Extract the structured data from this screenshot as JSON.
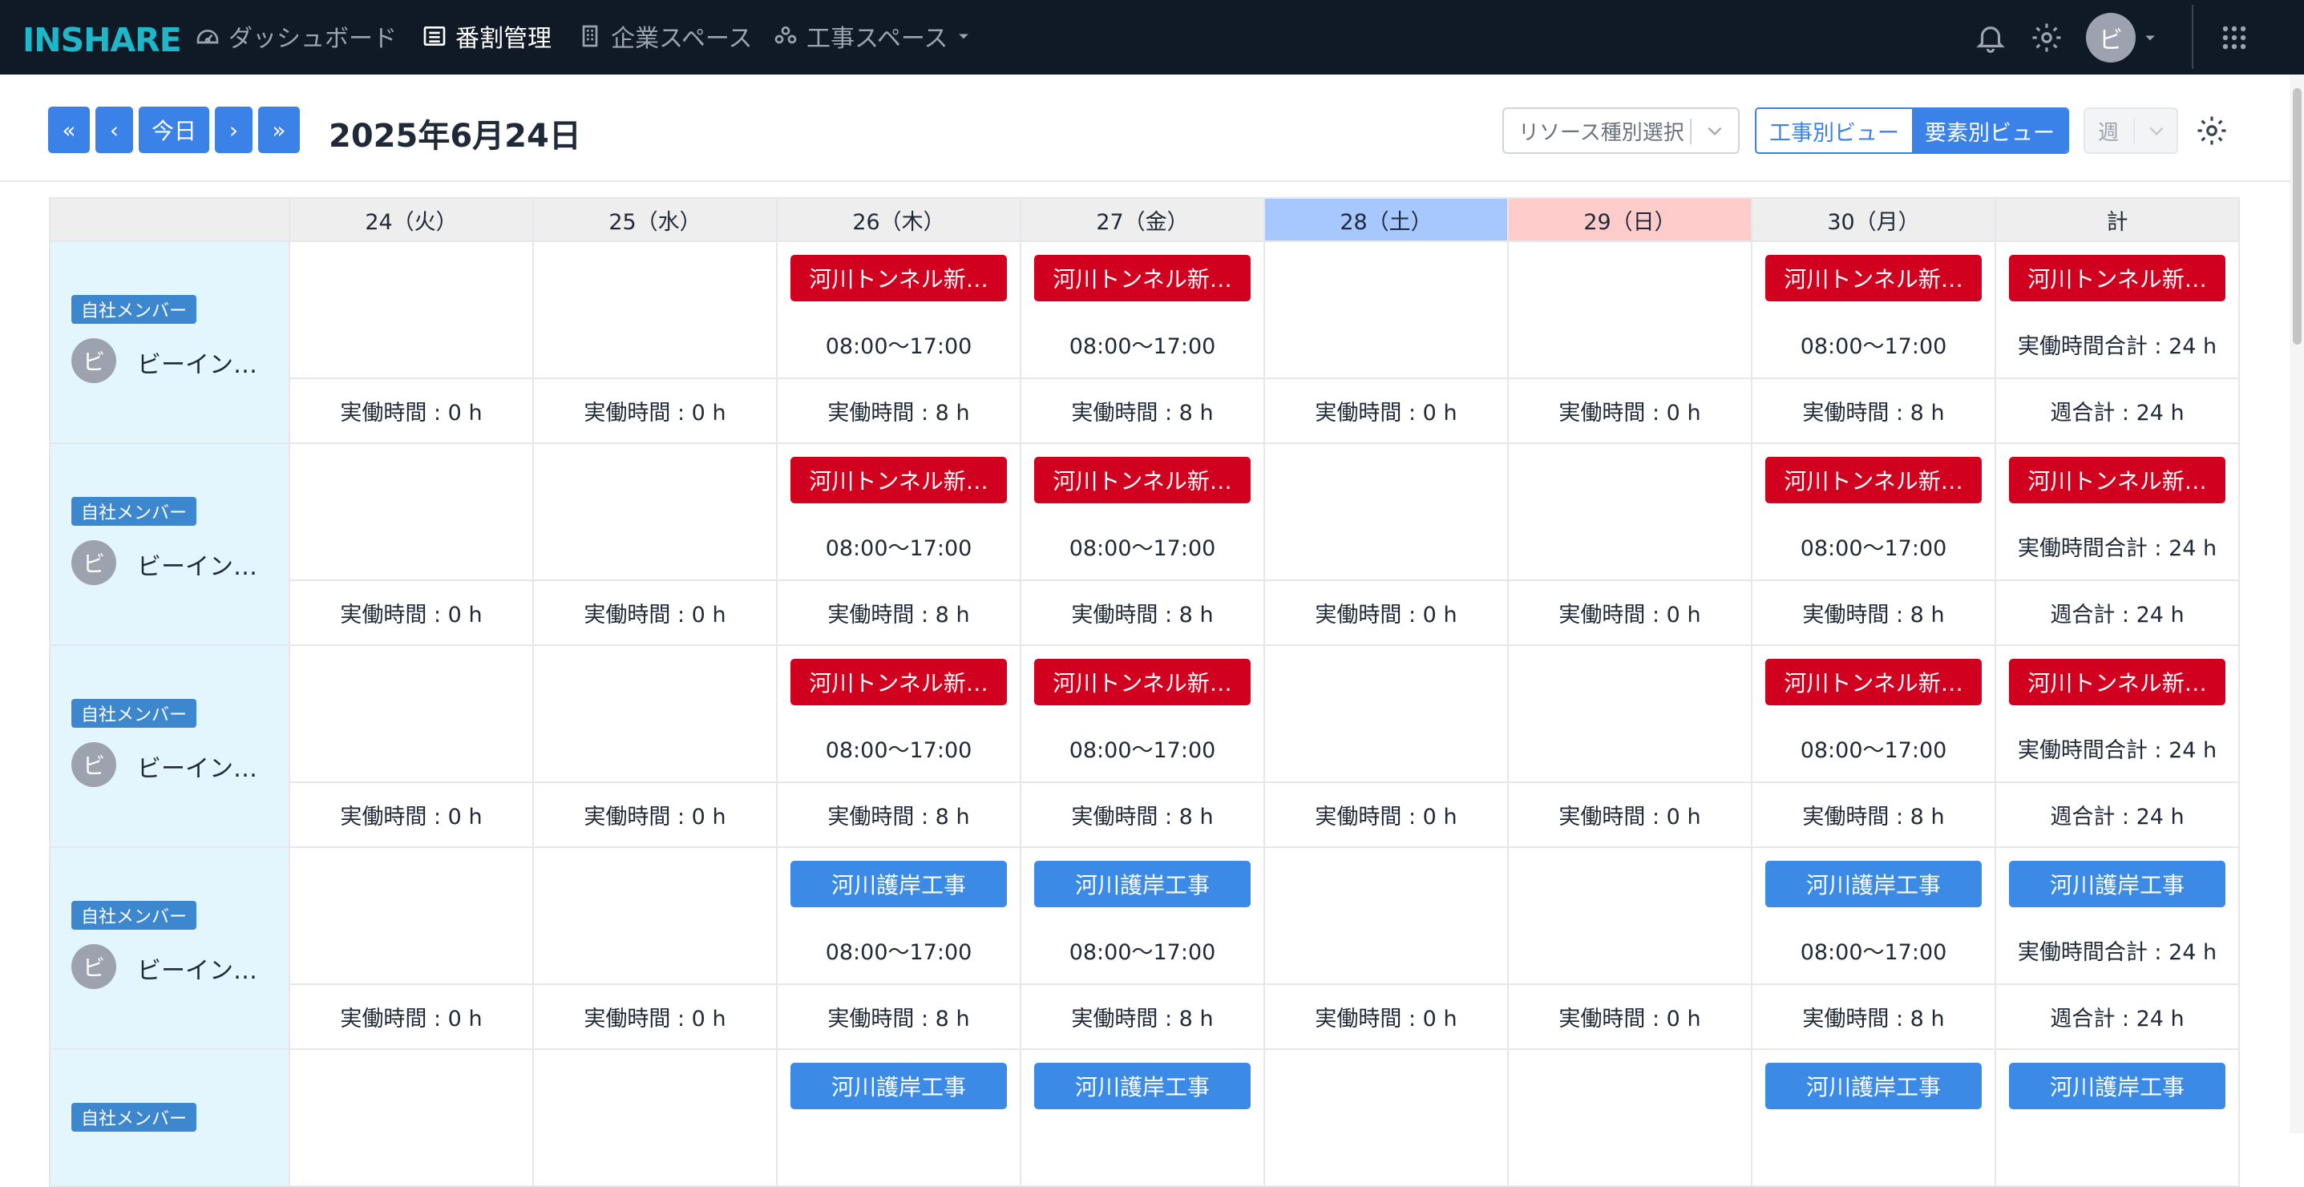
{
  "nav": {
    "logo": "INSHARE",
    "items": [
      {
        "label": "ダッシュボード",
        "icon": "dashboard-icon"
      },
      {
        "label": "番割管理",
        "icon": "list-icon"
      },
      {
        "label": "企業スペース",
        "icon": "building-icon"
      },
      {
        "label": "工事スペース",
        "icon": "users-icon"
      }
    ],
    "avatar": "ビ"
  },
  "toolbar": {
    "first": "«",
    "prev": "‹",
    "today": "今日",
    "next": "›",
    "last": "»",
    "date": "2025年6月24日",
    "resource_placeholder": "リソース種別選択",
    "view_by_project": "工事別ビュー",
    "view_by_element": "要素別ビュー",
    "period": "週"
  },
  "columns": [
    "24（火）",
    "25（水）",
    "26（木）",
    "27（金）",
    "28（土）",
    "29（日）",
    "30（月）",
    "計"
  ],
  "badge": "自社メンバー",
  "rows": [
    {
      "avatar": "ビ",
      "name": "ビーイン…",
      "tag": "河川トンネル新…",
      "time": "08:00〜17:00",
      "hours": [
        "実働時間 : 0 h",
        "実働時間 : 0 h",
        "実働時間 : 8 h",
        "実働時間 : 8 h",
        "実働時間 : 0 h",
        "実働時間 : 0 h",
        "実働時間 : 8 h",
        "週合計 : 24 h"
      ],
      "total": "実働時間合計 : 24 h"
    },
    {
      "avatar": "ビ",
      "name": "ビーイン…",
      "tag": "河川トンネル新…",
      "time": "08:00〜17:00",
      "hours": [
        "実働時間 : 0 h",
        "実働時間 : 0 h",
        "実働時間 : 8 h",
        "実働時間 : 8 h",
        "実働時間 : 0 h",
        "実働時間 : 0 h",
        "実働時間 : 8 h",
        "週合計 : 24 h"
      ],
      "total": "実働時間合計 : 24 h"
    },
    {
      "avatar": "ビ",
      "name": "ビーイン…",
      "tag": "河川トンネル新…",
      "time": "08:00〜17:00",
      "hours": [
        "実働時間 : 0 h",
        "実働時間 : 0 h",
        "実働時間 : 8 h",
        "実働時間 : 8 h",
        "実働時間 : 0 h",
        "実働時間 : 0 h",
        "実働時間 : 8 h",
        "週合計 : 24 h"
      ],
      "total": "実働時間合計 : 24 h"
    },
    {
      "avatar": "ビ",
      "name": "ビーイン…",
      "tag": "河川護岸工事",
      "time": "08:00〜17:00",
      "hours": [
        "実働時間 : 0 h",
        "実働時間 : 0 h",
        "実働時間 : 8 h",
        "実働時間 : 8 h",
        "実働時間 : 0 h",
        "実働時間 : 0 h",
        "実働時間 : 8 h",
        "週合計 : 24 h"
      ],
      "total": "実働時間合計 : 24 h"
    },
    {
      "tag": "河川護岸工事"
    }
  ],
  "colors": {
    "nav_bg": "#101a27",
    "accent": "#3b82e8",
    "red_tag": "#d1001f",
    "blue_tag": "#3b8ae6",
    "sat": "#a6c8ff",
    "sun": "#ffcccc",
    "member_bg": "#e3f5fd"
  }
}
